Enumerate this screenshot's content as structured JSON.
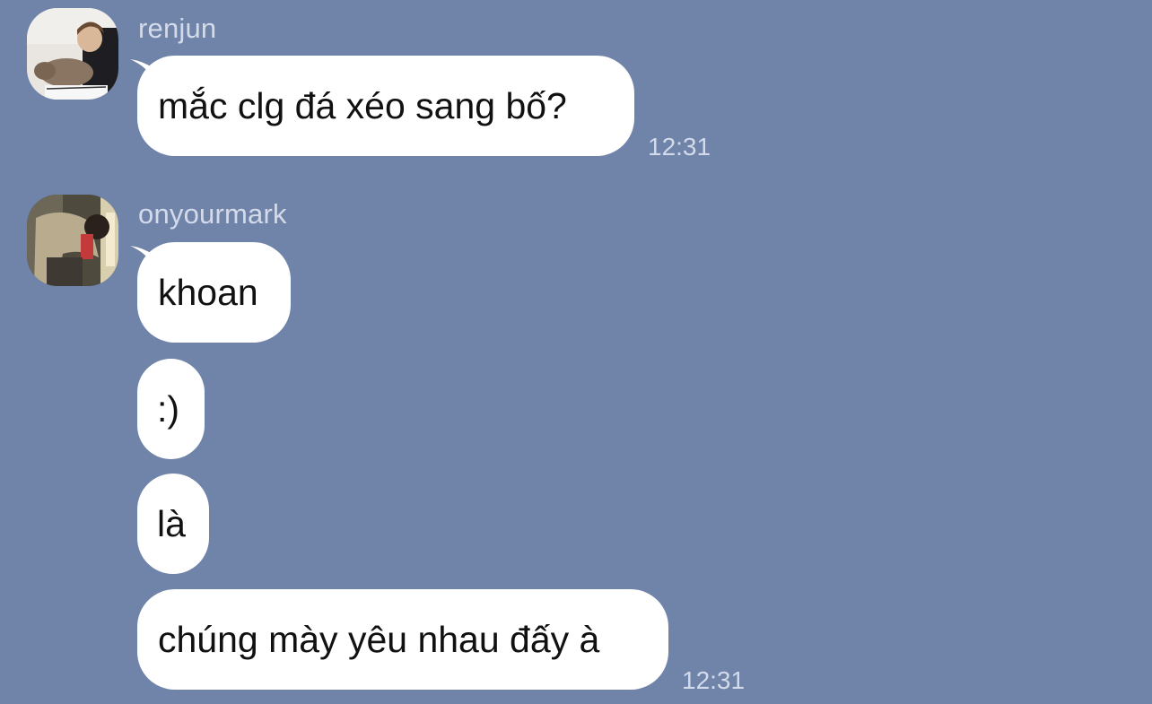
{
  "chat": {
    "background_color": "#7083a9",
    "groups": [
      {
        "sender": "renjun",
        "avatar_icon": "user-avatar-photo-icon",
        "messages": [
          "mắc clg đá xéo sang bố?"
        ],
        "time": "12:31"
      },
      {
        "sender": "onyourmark",
        "avatar_icon": "user-avatar-photo-icon",
        "messages": [
          "khoan",
          ":)",
          "là",
          "chúng mày yêu nhau đấy à"
        ],
        "time": "12:31"
      }
    ]
  }
}
